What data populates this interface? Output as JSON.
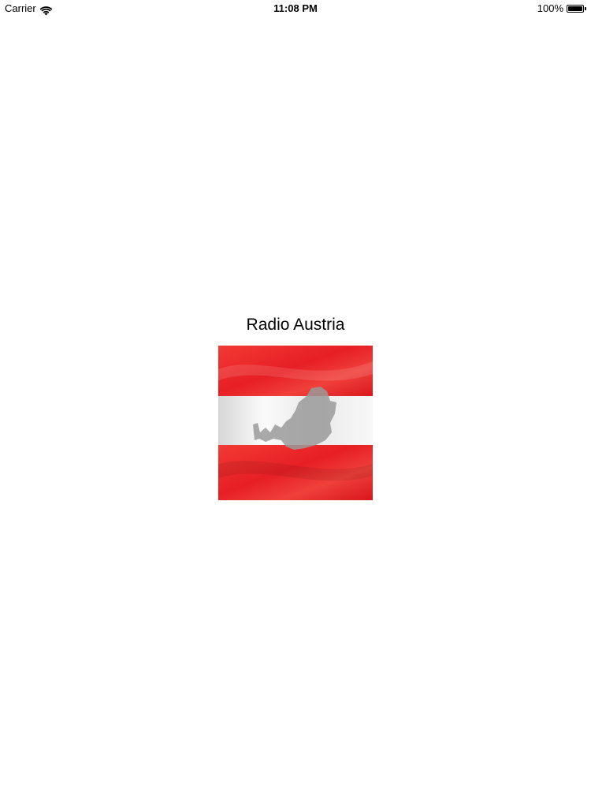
{
  "status_bar": {
    "carrier": "Carrier",
    "time": "11:08 PM",
    "battery_text": "100%",
    "battery_level": 1.0,
    "wifi_icon": "wifi-icon",
    "battery_icon": "battery-icon"
  },
  "main": {
    "title": "Radio Austria",
    "logo_icon": "austria-flag-map-logo"
  },
  "colors": {
    "flag_red": "#ee2427",
    "flag_white": "#f4f4f4",
    "map_gray": "#9a9a9a"
  }
}
